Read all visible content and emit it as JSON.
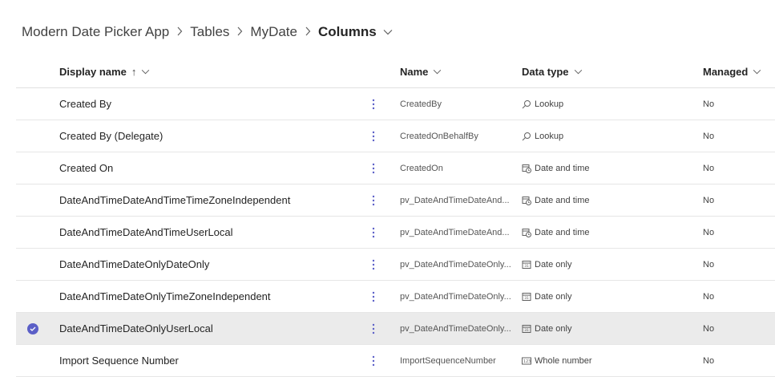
{
  "breadcrumb": {
    "app": "Modern Date Picker App",
    "tables": "Tables",
    "table": "MyDate",
    "current": "Columns"
  },
  "columns": {
    "display_name": "Display name",
    "sort_arrow": "↑",
    "name": "Name",
    "data_type": "Data type",
    "managed": "Managed"
  },
  "rows": [
    {
      "display": "Created By",
      "name": "CreatedBy",
      "type": "Lookup",
      "type_icon": "search-icon",
      "managed": "No",
      "selected": false
    },
    {
      "display": "Created By (Delegate)",
      "name": "CreatedOnBehalfBy",
      "type": "Lookup",
      "type_icon": "search-icon",
      "managed": "No",
      "selected": false
    },
    {
      "display": "Created On",
      "name": "CreatedOn",
      "type": "Date and time",
      "type_icon": "calendar-clock-icon",
      "managed": "No",
      "selected": false
    },
    {
      "display": "DateAndTimeDateAndTimeTimeZoneIndependent",
      "name": "pv_DateAndTimeDateAnd...",
      "type": "Date and time",
      "type_icon": "calendar-clock-icon",
      "managed": "No",
      "selected": false
    },
    {
      "display": "DateAndTimeDateAndTimeUserLocal",
      "name": "pv_DateAndTimeDateAnd...",
      "type": "Date and time",
      "type_icon": "calendar-clock-icon",
      "managed": "No",
      "selected": false
    },
    {
      "display": "DateAndTimeDateOnlyDateOnly",
      "name": "pv_DateAndTimeDateOnly...",
      "type": "Date only",
      "type_icon": "calendar-icon",
      "managed": "No",
      "selected": false
    },
    {
      "display": "DateAndTimeDateOnlyTimeZoneIndependent",
      "name": "pv_DateAndTimeDateOnly...",
      "type": "Date only",
      "type_icon": "calendar-icon",
      "managed": "No",
      "selected": false
    },
    {
      "display": "DateAndTimeDateOnlyUserLocal",
      "name": "pv_DateAndTimeDateOnly...",
      "type": "Date only",
      "type_icon": "calendar-icon",
      "managed": "No",
      "selected": true
    },
    {
      "display": "Import Sequence Number",
      "name": "ImportSequenceNumber",
      "type": "Whole number",
      "type_icon": "number-icon",
      "managed": "No",
      "selected": false
    }
  ],
  "colors": {
    "accent": "#5b5fc7",
    "selected_row": "#ebebeb"
  }
}
